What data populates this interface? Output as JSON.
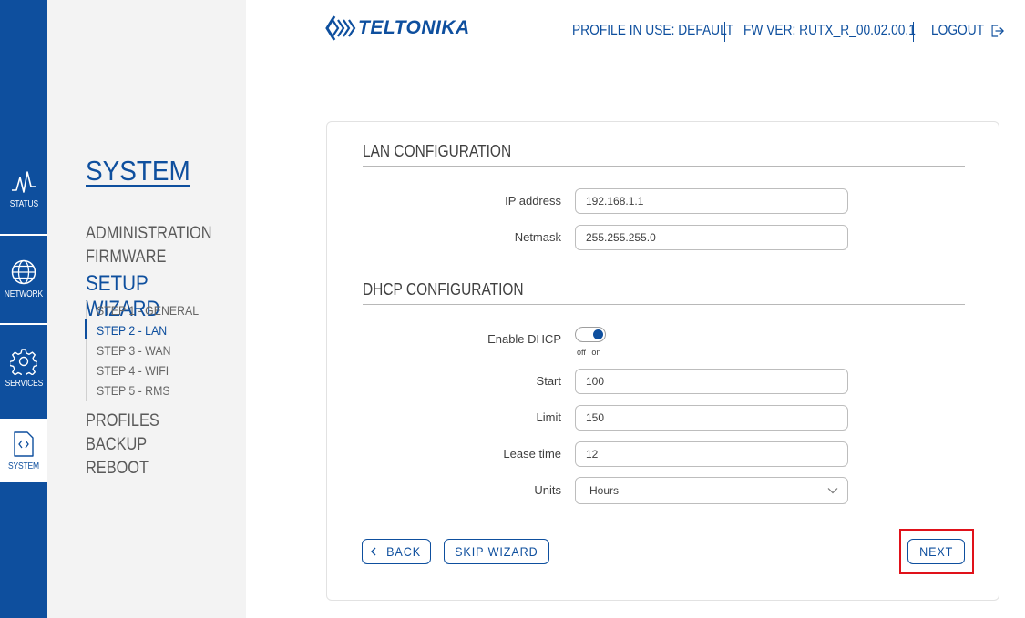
{
  "rail": {
    "items": [
      {
        "label": "STATUS",
        "icon": "status-wave-icon"
      },
      {
        "label": "NETWORK",
        "icon": "globe-icon"
      },
      {
        "label": "SERVICES",
        "icon": "gear-icon"
      },
      {
        "label": "SYSTEM",
        "icon": "code-file-icon",
        "active": true
      }
    ]
  },
  "subnav": {
    "title": "SYSTEM",
    "items": [
      {
        "label": "ADMINISTRATION"
      },
      {
        "label": "FIRMWARE"
      },
      {
        "label": "SETUP WIZARD",
        "active": true
      },
      {
        "label": "PROFILES"
      },
      {
        "label": "BACKUP"
      },
      {
        "label": "REBOOT"
      }
    ],
    "steps": [
      {
        "label": "STEP 1 - GENERAL"
      },
      {
        "label": "STEP 2 - LAN",
        "active": true
      },
      {
        "label": "STEP 3 - WAN"
      },
      {
        "label": "STEP 4 - WIFI"
      },
      {
        "label": "STEP 5 - RMS"
      }
    ]
  },
  "header": {
    "brand": "TELTONIKA",
    "profile": "PROFILE IN USE: DEFAULT",
    "fw": "FW VER: RUTX_R_00.02.00.1",
    "logout": "LOGOUT"
  },
  "lan": {
    "heading": "LAN CONFIGURATION",
    "ip_label": "IP address",
    "ip_value": "192.168.1.1",
    "netmask_label": "Netmask",
    "netmask_value": "255.255.255.0"
  },
  "dhcp": {
    "heading": "DHCP CONFIGURATION",
    "enable_label": "Enable DHCP",
    "enable_state": "on",
    "toggle_off": "off",
    "toggle_on": "on",
    "start_label": "Start",
    "start_value": "100",
    "limit_label": "Limit",
    "limit_value": "150",
    "lease_label": "Lease time",
    "lease_value": "12",
    "units_label": "Units",
    "units_value": "Hours"
  },
  "buttons": {
    "back": "BACK",
    "skip": "SKIP WIZARD",
    "next": "NEXT"
  },
  "colors": {
    "brand_blue": "#0e4f9e",
    "highlight_red": "#e0121a",
    "subnav_bg": "#f3f3f3"
  }
}
